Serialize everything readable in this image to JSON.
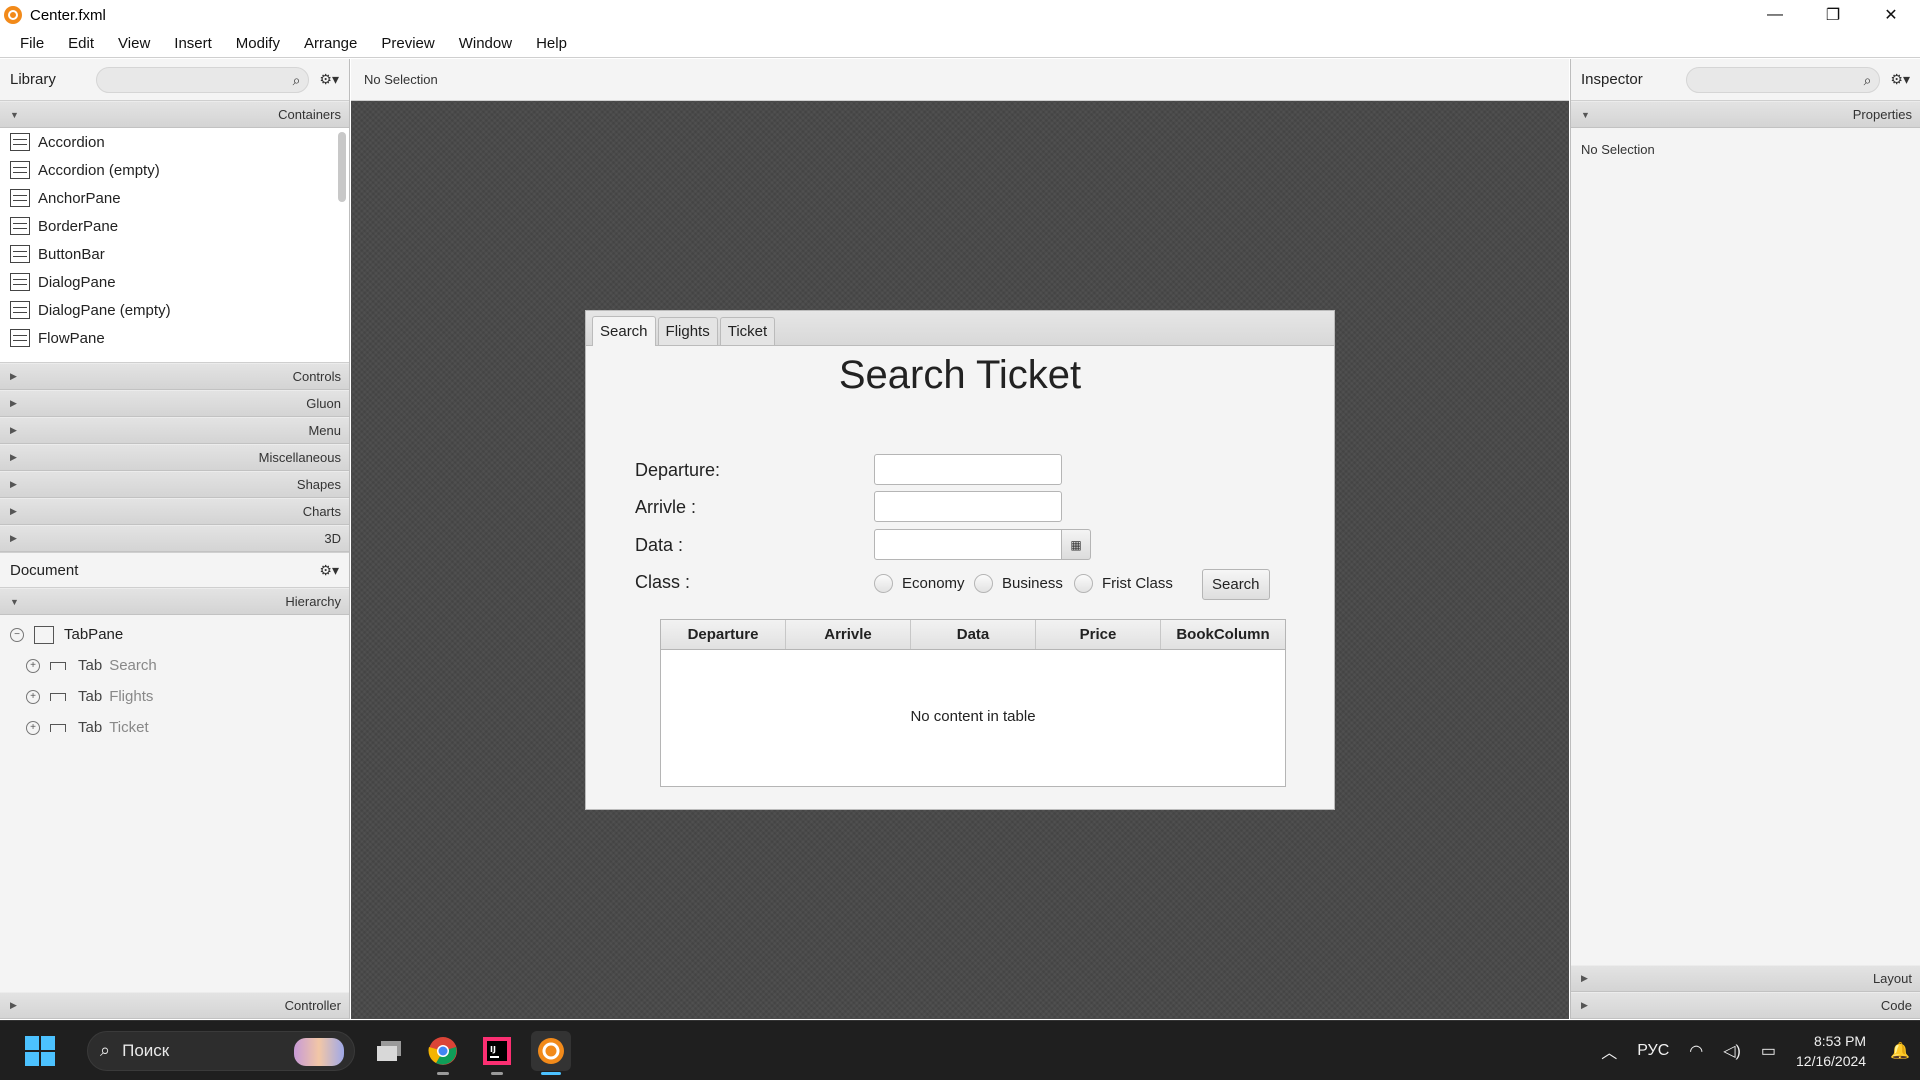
{
  "window": {
    "title": "Center.fxml",
    "controls": [
      "—",
      "❐",
      "✕"
    ]
  },
  "menu": [
    "File",
    "Edit",
    "View",
    "Insert",
    "Modify",
    "Arrange",
    "Preview",
    "Window",
    "Help"
  ],
  "library": {
    "title": "Library",
    "search_placeholder": "",
    "containers_label": "Containers",
    "items": [
      "Accordion",
      "Accordion  (empty)",
      "AnchorPane",
      "BorderPane",
      "ButtonBar",
      "DialogPane",
      "DialogPane  (empty)",
      "FlowPane"
    ],
    "sections": [
      "Controls",
      "Gluon",
      "Menu",
      "Miscellaneous",
      "Shapes",
      "Charts",
      "3D"
    ]
  },
  "document": {
    "title": "Document",
    "hierarchy_label": "Hierarchy",
    "root": "TabPane",
    "tabs": [
      {
        "kind": "Tab",
        "name": "Search"
      },
      {
        "kind": "Tab",
        "name": "Flights"
      },
      {
        "kind": "Tab",
        "name": "Ticket"
      }
    ],
    "controller_label": "Controller"
  },
  "center": {
    "selection": "No Selection"
  },
  "form": {
    "tabs": [
      "Search",
      "Flights",
      "Ticket"
    ],
    "heading": "Search Ticket",
    "departure_label": "Departure:",
    "arrival_label": "Arrivle :",
    "date_label": "Data :",
    "class_label": "Class :",
    "departure_value": "",
    "arrival_value": "",
    "date_value": "",
    "radios": [
      "Economy",
      "Business",
      "Frist Class"
    ],
    "search_button": "Search",
    "columns": [
      "Departure",
      "Arrivle",
      "Data",
      "Price",
      "BookColumn"
    ],
    "empty_table": "No content in table"
  },
  "inspector": {
    "title": "Inspector",
    "properties_label": "Properties",
    "no_selection": "No Selection",
    "layout_label": "Layout",
    "code_label": "Code"
  },
  "taskbar": {
    "search_text": "Поиск",
    "language": "РУС",
    "time": "8:53 PM",
    "date": "12/16/2024"
  },
  "colors": {
    "accent": "#4cc2ff",
    "app_icon": "#f28a1a",
    "canvas_bg": "#4a4a4a"
  }
}
